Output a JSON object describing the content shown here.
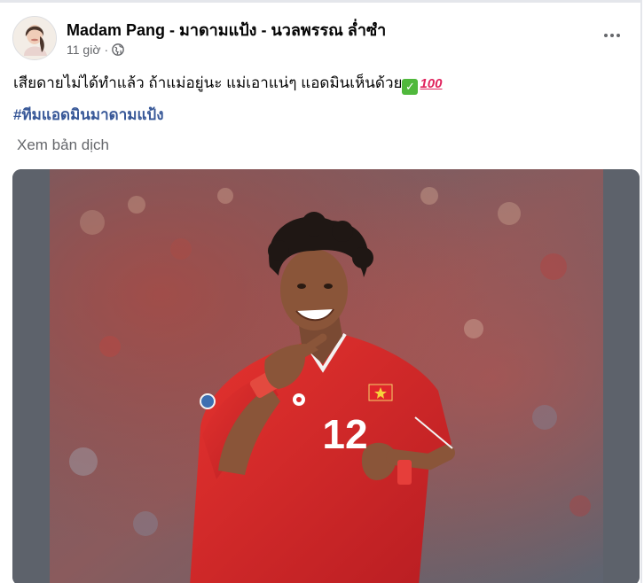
{
  "post": {
    "author_name": "Madam Pang - มาดามแป้ง - นวลพรรณ ล่ำซำ",
    "time": "11 giờ",
    "separator": "·",
    "privacy_icon": "globe-icon",
    "more_icon": "more-horizontal-icon",
    "text": "เสียดายไม่ได้ทำแล้ว ถ้าแม่อยู่นะ แม่เอาแน่ๆ แอดมินเห็นด้วย",
    "emoji_check": "✓",
    "emoji_100": "100",
    "hashtag": "#ทีมแอดมินมาดามแป้ง",
    "translate_label": "Xem bản dịch",
    "photo": {
      "description_icon": "football-player-photo",
      "jersey_number": "12"
    }
  },
  "colors": {
    "name": "#050505",
    "meta": "#65676b",
    "hashtag": "#385898",
    "jersey": "#d7262b",
    "background_crowd": "#7a6f76"
  }
}
